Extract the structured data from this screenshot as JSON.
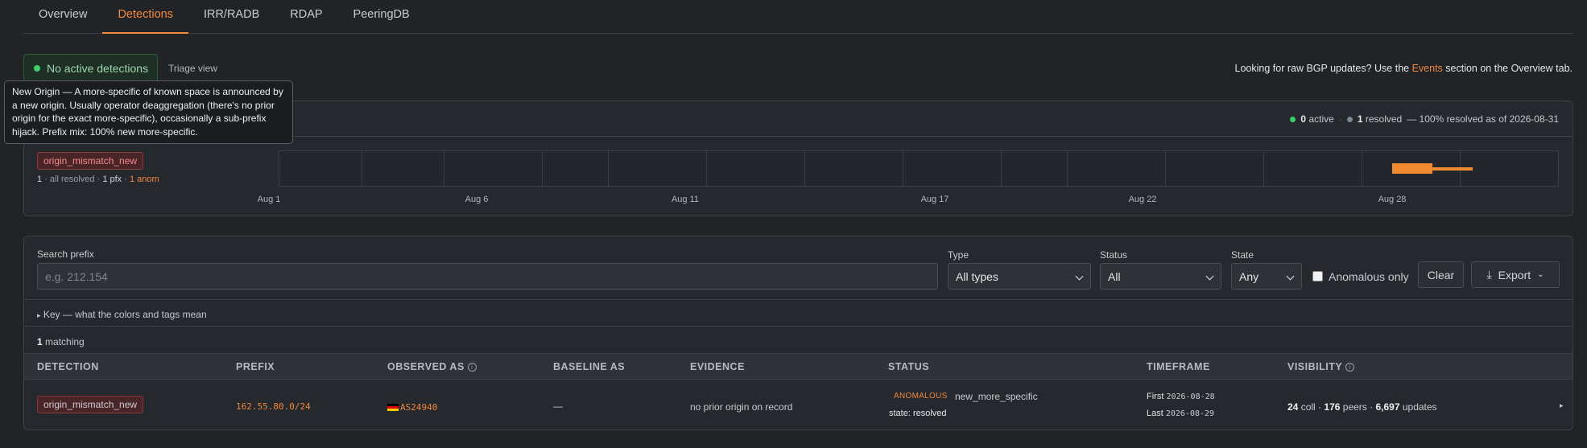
{
  "tabs": [
    "Overview",
    "Detections",
    "IRR/RADB",
    "RDAP",
    "PeeringDB"
  ],
  "active_tab": "Detections",
  "status": {
    "label": "No active detections",
    "triage_link": "Triage view"
  },
  "hint": {
    "prefix": "Looking for raw BGP updates? Use the ",
    "link": "Events",
    "suffix": " section on the Overview tab."
  },
  "tooltip": "New Origin — A more-specific of known space is announced by a new origin. Usually operator deaggregation (there's no prior origin for the exact more-specific), occasionally a sub-prefix hijack. Prefix mix: 100% new more-specific.",
  "timeline": {
    "active_count": "0",
    "active_label": "active",
    "resolved_count": "1",
    "resolved_label": "resolved",
    "resolved_note": "— 100% resolved as of 2026-08-31",
    "lane_tag": "origin_mismatch_new",
    "lane_meta": {
      "count": "1",
      "resolved": "all resolved",
      "pfx": "1 pfx",
      "anom": "1 anom"
    },
    "axis_labels": [
      "Aug 1",
      "Aug 6",
      "Aug 11",
      "Aug 17",
      "Aug 22",
      "Aug 28"
    ]
  },
  "filters": {
    "search_label": "Search prefix",
    "search_placeholder": "e.g. 212.154",
    "type_label": "Type",
    "type_value": "All types",
    "status_label": "Status",
    "status_value": "All",
    "state_label": "State",
    "state_value": "Any",
    "anomalous_label": "Anomalous only",
    "clear_label": "Clear",
    "export_label": "Export"
  },
  "key_label": "Key — what the colors and tags mean",
  "matching": {
    "count": "1",
    "label": "matching"
  },
  "table": {
    "headers": [
      "DETECTION",
      "PREFIX",
      "OBSERVED AS",
      "BASELINE AS",
      "EVIDENCE",
      "STATUS",
      "TIMEFRAME",
      "VISIBILITY"
    ],
    "rows": [
      {
        "detection": "origin_mismatch_new",
        "prefix": "162.55.80.0/24",
        "observed_as": "AS24940",
        "baseline_as": "—",
        "evidence": "no prior origin on record",
        "status_badge": "ANOMALOUS",
        "status_type": "new_more_specific",
        "state": "state: resolved",
        "first_label": "First",
        "first_date": "2026-08-28",
        "last_label": "Last",
        "last_date": "2026-08-29",
        "coll": "24",
        "coll_label": "coll ·",
        "peers": "176",
        "peers_label": "peers ·",
        "updates": "6,697",
        "updates_label": "updates"
      }
    ]
  }
}
